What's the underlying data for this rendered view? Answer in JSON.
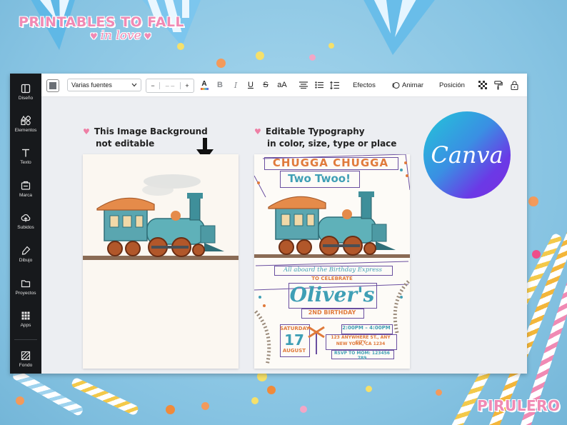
{
  "brand": {
    "line1": "PRINTABLES TO FALL",
    "line2": "in love",
    "watermark": "PIRULERO"
  },
  "sidebar": {
    "items": [
      {
        "label": "Diseño",
        "icon": "layout-icon"
      },
      {
        "label": "Elementos",
        "icon": "shapes-icon"
      },
      {
        "label": "Texto",
        "icon": "text-icon"
      },
      {
        "label": "Marca",
        "icon": "brand-icon"
      },
      {
        "label": "Subidos",
        "icon": "upload-icon"
      },
      {
        "label": "Dibujo",
        "icon": "draw-icon"
      },
      {
        "label": "Proyectos",
        "icon": "folder-icon"
      },
      {
        "label": "Apps",
        "icon": "apps-grid-icon"
      },
      {
        "label": "Fondo",
        "icon": "background-pattern-icon"
      }
    ]
  },
  "toolbar": {
    "font_select": "Varias fuentes",
    "decrease": "−",
    "font_size": "– –",
    "increase": "+",
    "color_letter": "A",
    "bold": "B",
    "italic": "I",
    "underline": "U",
    "strike": "S",
    "case": "aA",
    "effects": "Efectos",
    "animate": "Animar",
    "position": "Posición"
  },
  "notes": {
    "left_line1": "This Image Background",
    "left_line2": "not editable",
    "right_line1": "Editable Typography",
    "right_line2": "in color, size, type or place"
  },
  "canva_logo": "Canva",
  "invitation": {
    "title1": "CHUGGA CHUGGA",
    "title2": "Two Twoo!",
    "aboard": "All aboard the Birthday Express",
    "celebrate": "TO CELEBRATE",
    "name": "Oliver's",
    "birthday": "2ND BIRTHDAY",
    "day_name": "SATURDAY",
    "day_num": "17",
    "month": "AUGUST",
    "time": "2:00PM – 4:00PM",
    "address1": "123 ANYWHERE ST., ANY CITY",
    "address2": "NEW YORK, CA 1234",
    "rsvp": "RSVP TO MOM: 123456 789"
  },
  "colors": {
    "brand_pink": "#f08ab4",
    "sidebar_bg": "#17191c",
    "canvas_bg": "#eceef2",
    "invite_orange": "#e07a3b",
    "invite_teal": "#3f9fb5",
    "invite_purple": "#6a4fa0"
  }
}
